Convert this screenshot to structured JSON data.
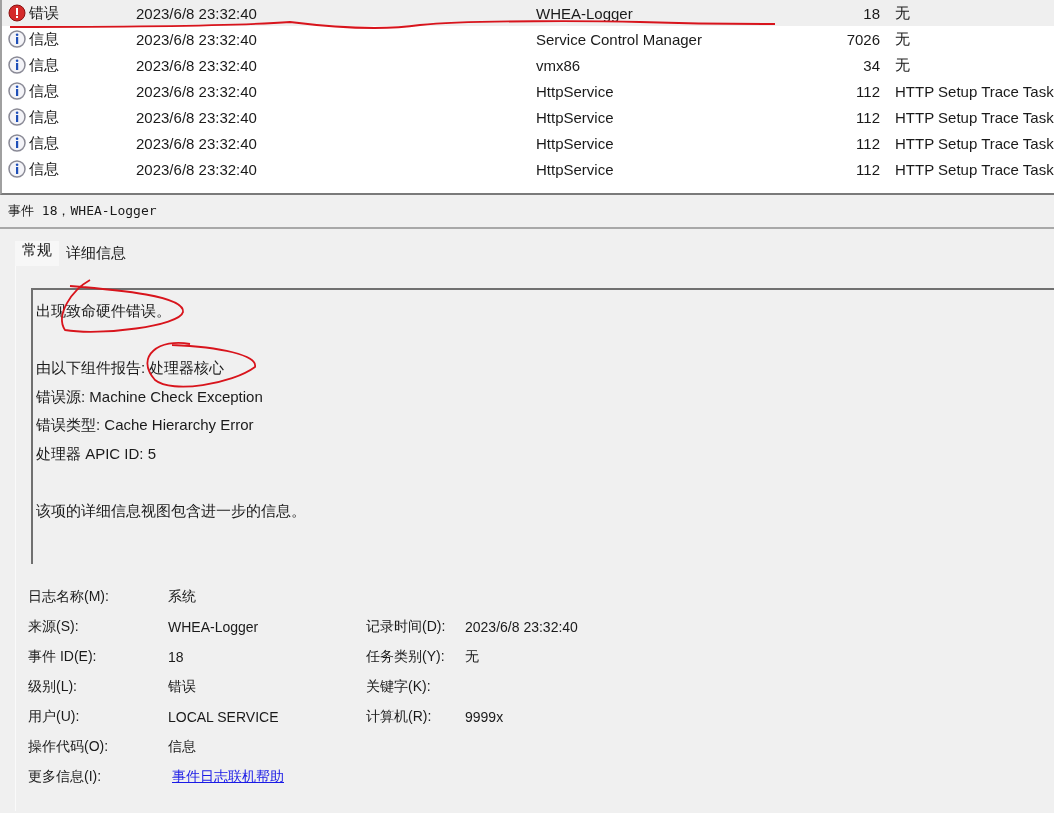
{
  "events": [
    {
      "kind": "error",
      "level": "错误",
      "date": "2023/6/8 23:32:40",
      "source": "WHEA-Logger",
      "event_id": "18",
      "task": "无",
      "selected": true
    },
    {
      "kind": "info",
      "level": "信息",
      "date": "2023/6/8 23:32:40",
      "source": "Service Control Manager",
      "event_id": "7026",
      "task": "无",
      "selected": false
    },
    {
      "kind": "info",
      "level": "信息",
      "date": "2023/6/8 23:32:40",
      "source": "vmx86",
      "event_id": "34",
      "task": "无",
      "selected": false
    },
    {
      "kind": "info",
      "level": "信息",
      "date": "2023/6/8 23:32:40",
      "source": "HttpService",
      "event_id": "112",
      "task": "HTTP Setup Trace Task",
      "selected": false
    },
    {
      "kind": "info",
      "level": "信息",
      "date": "2023/6/8 23:32:40",
      "source": "HttpService",
      "event_id": "112",
      "task": "HTTP Setup Trace Task",
      "selected": false
    },
    {
      "kind": "info",
      "level": "信息",
      "date": "2023/6/8 23:32:40",
      "source": "HttpService",
      "event_id": "112",
      "task": "HTTP Setup Trace Task",
      "selected": false
    },
    {
      "kind": "info",
      "level": "信息",
      "date": "2023/6/8 23:32:40",
      "source": "HttpService",
      "event_id": "112",
      "task": "HTTP Setup Trace Task",
      "selected": false
    }
  ],
  "detail_title": "事件 18，WHEA-Logger",
  "tabs": [
    {
      "label": "常规",
      "selected": true
    },
    {
      "label": "详细信息",
      "selected": false
    }
  ],
  "description": [
    {
      "lines": [
        "出现致命硬件错误。"
      ]
    },
    {
      "lines": [
        "由以下组件报告: 处理器核心",
        "错误源: Machine Check Exception",
        "错误类型: Cache Hierarchy Error",
        "处理器 APIC ID: 5"
      ]
    },
    {
      "lines": [
        "该项的详细信息视图包含进一步的信息。"
      ]
    }
  ],
  "fields": [
    {
      "label": "日志名称(M):",
      "value": "系统"
    },
    {
      "label": "来源(S):",
      "value": "WHEA-Logger",
      "label2": "记录时间(D):",
      "value2": "2023/6/8 23:32:40"
    },
    {
      "label": "事件 ID(E):",
      "value": "18",
      "label2": "任务类别(Y):",
      "value2": "无"
    },
    {
      "label": "级别(L):",
      "value": "错误",
      "label2": "关键字(K):"
    },
    {
      "label": "用户(U):",
      "value": "LOCAL SERVICE",
      "label2": "计算机(R):",
      "value2": "9999x"
    },
    {
      "label": "操作代码(O):",
      "value": "信息"
    },
    {
      "label": "更多信息(I):",
      "value": "事件日志联机帮助",
      "kind": "link"
    }
  ]
}
